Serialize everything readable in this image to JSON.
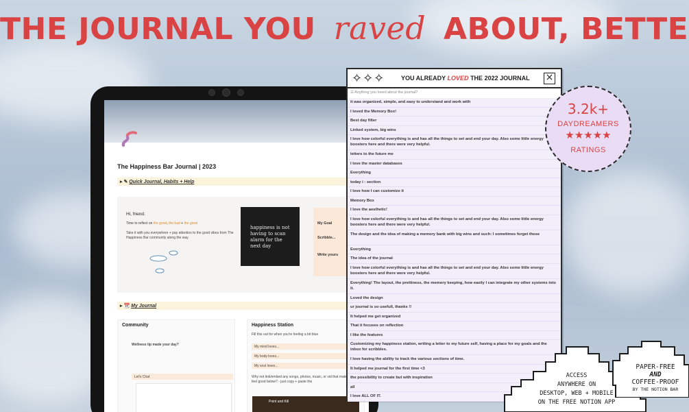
{
  "headline": {
    "part1": "THE JOURNAL YOU",
    "script_word": "raved",
    "part2": "ABOUT, BETTER"
  },
  "notion_page": {
    "title": "The Happiness Bar Journal | 2023",
    "toggle_quick": "Quick Journal, Habits + Help",
    "toggle_my_journal": "My Journal",
    "greeting": "Hi, friend.",
    "time_line_prefix": "Time to reflect on",
    "good": "the good",
    "bad": "the bad",
    "great": "the great",
    "take_it": "Take it with you everywhere + pay attention to the good vibes from The Happiness Bar community along the way.",
    "dark_card_text": "happiness is not having to scan alarm for the next day",
    "peach_items": [
      "My Goal",
      "Scribble...",
      "Write yours"
    ],
    "community_title": "Community",
    "community_tip": "Wellness tip made your day?",
    "lets_chat": "Let's Chat",
    "happiness_station_title": "Happiness Station",
    "happiness_station_sub": "Fill this out for when you're feeling a bit blue",
    "mind_loves": "My mind loves...",
    "body_loves": "My body loves...",
    "soul_loves": "My soul loves...",
    "why_not": "Why not link/embed any songs, photos, music, or vid that make you feel good below? - just copy + paste the",
    "song_label": "Point and Kill"
  },
  "popup": {
    "title_prefix": "YOU ALREADY",
    "title_loved": "LOVED",
    "title_suffix": "THE 2022 JOURNAL",
    "close_icon": "close-icon",
    "question": "Anything you loved about the journal?",
    "answers": [
      "it was organized, simple, and easy to understand and work with",
      "I loved the Memory Box!",
      "Best day filter",
      "Linked system, big wins",
      "I love how colorful everything is and has all the things to set and end your day. Also some little energy boosters here and there were very helpful.",
      "letters to the future me",
      "I love the master databases",
      "Everything",
      "today i : section",
      "I love how I can customize it",
      "Memory Box",
      "I love the aesthetic!",
      "I love how colorful everything is and has all the things to set and end your day. Also some little energy boosters here and there were very helpful.",
      "The design and the idea of making a memory bank with big wins and such: I sometimes forget these",
      "Everything",
      "The idea of the journal",
      "I love how colorful everything is and has all the things to set and end your day. Also some little energy boosters here and there were very helpful.",
      "Everything! The layout, the prettiness, the memory keeping, how easily I can integrate my other systems into it.",
      "Loved the design",
      "ur journal is so usefull, thanks !!",
      "It helped me get organized",
      "That it focuses on reflection",
      "I like the features",
      "Customizing my happiness station, writing a letter to my future self, having a place for my goals and the inbox for scribbles.",
      "I love having the ability to track the various sections of time.",
      "It helped me journal for the first time <3",
      "the possibility to create but with inspiration",
      "all",
      "I love ALL OF IT."
    ]
  },
  "badge": {
    "count": "3.2k+",
    "label": "DAYDREAMERS",
    "stars": "★★★★★",
    "ratings": "RATINGS"
  },
  "access_cloud": {
    "line1": "ACCESS",
    "line2": "ANYWHERE ON",
    "line3": "DESKTOP, WEB + MOBILE",
    "line4": "ON THE FREE NOTION APP"
  },
  "paper_cloud": {
    "line1": "PAPER-FREE",
    "line2": "AND",
    "line3": "COFFEE-PROOF",
    "line4": "BY THE NOTION BAR"
  },
  "colors": {
    "accent_red": "#d94343",
    "badge_fill": "#e9dcf4",
    "answer_row": "#f3effa"
  }
}
